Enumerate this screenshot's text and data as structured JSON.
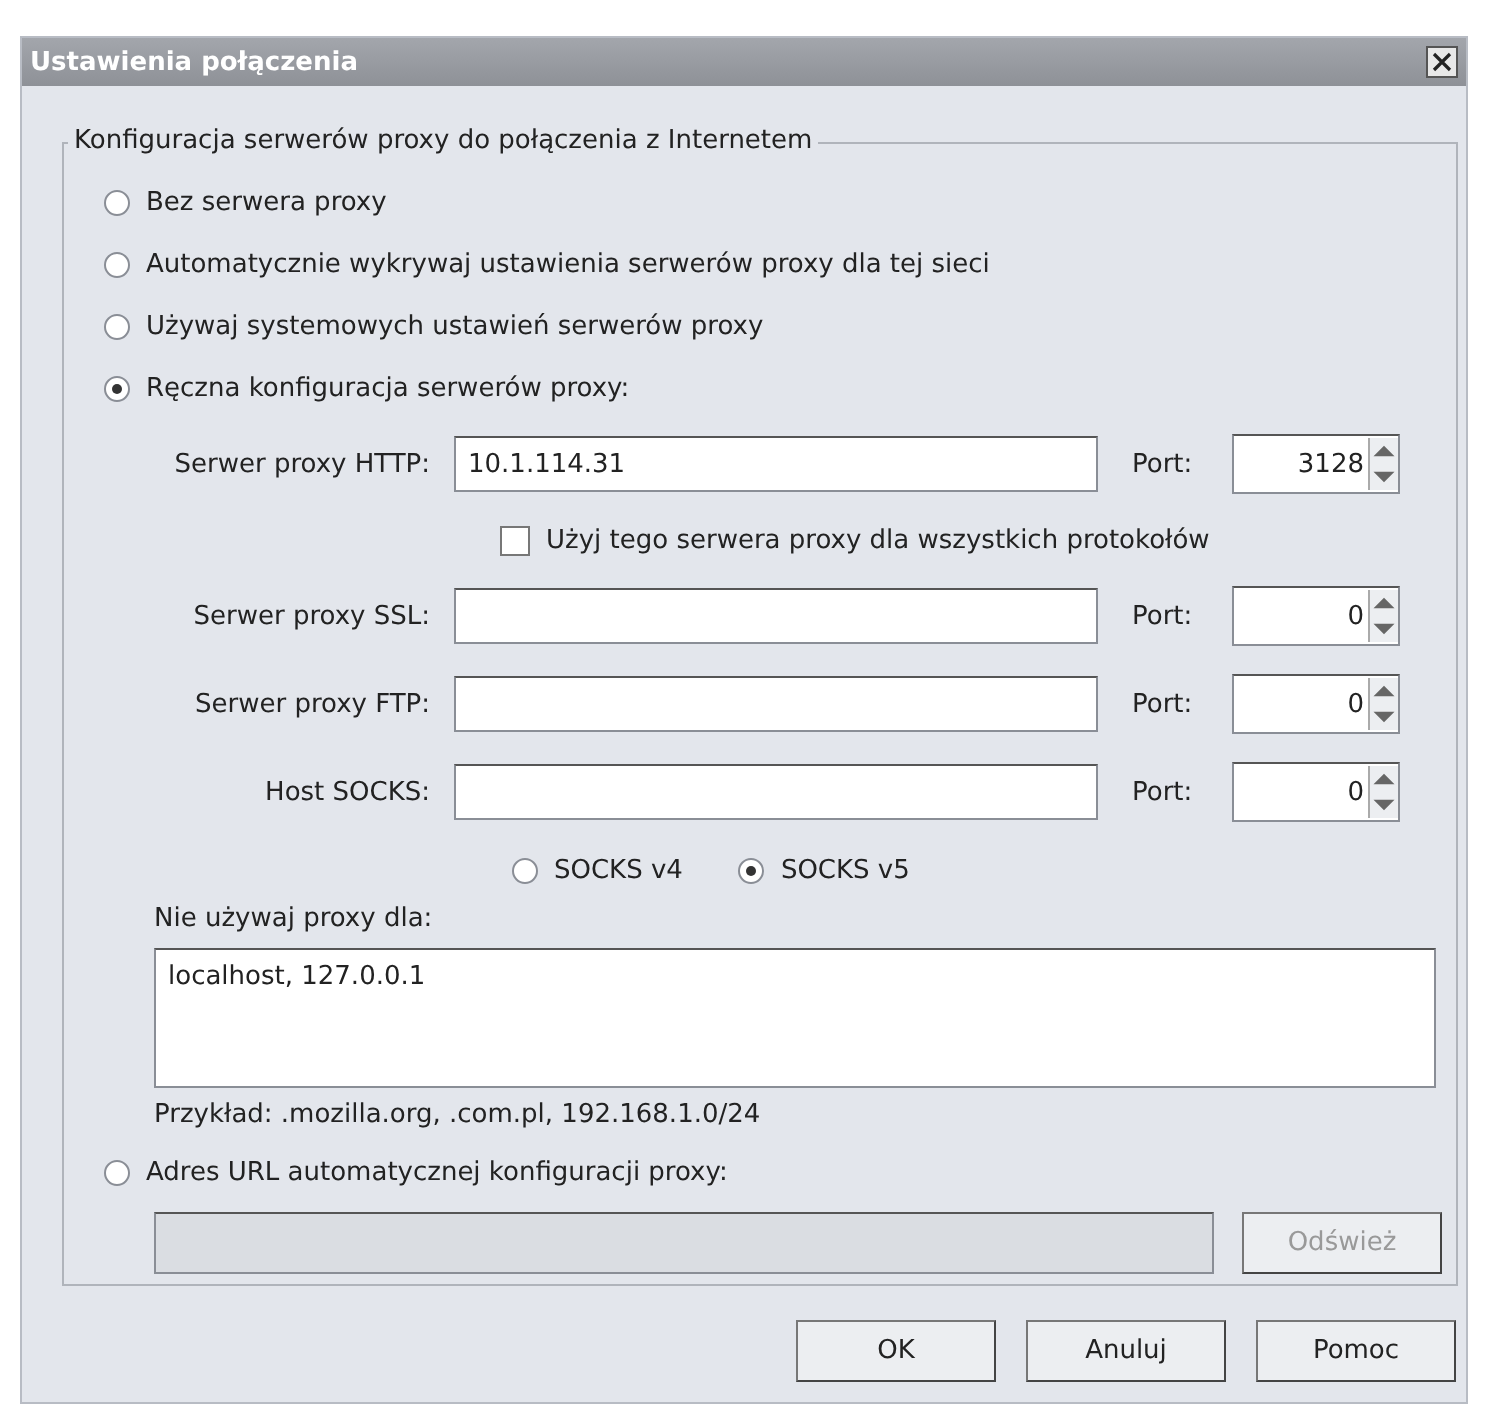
{
  "window": {
    "title": "Ustawienia połączenia"
  },
  "proxy_group": {
    "legend": "Konfiguracja serwerów proxy do połączenia z Internetem",
    "modes": [
      {
        "label": "Bez serwera proxy",
        "selected": false
      },
      {
        "label": "Automatycznie wykrywaj ustawienia serwerów proxy dla tej sieci",
        "selected": false
      },
      {
        "label": "Używaj systemowych ustawień serwerów proxy",
        "selected": false
      },
      {
        "label": "Ręczna konfiguracja serwerów proxy:",
        "selected": true
      }
    ],
    "servers": [
      {
        "label": "Serwer proxy HTTP:",
        "value": "10.1.114.31",
        "port_label": "Port:",
        "port": "3128"
      },
      {
        "label": "Serwer proxy SSL:",
        "port_label": "Port:",
        "port": "0"
      },
      {
        "label": "Serwer proxy FTP:",
        "port_label": "Port:",
        "port": "0"
      },
      {
        "label": "Host SOCKS:",
        "port_label": "Port:",
        "port": "0"
      }
    ],
    "use_for_all": {
      "label": "Użyj tego serwera proxy dla wszystkich protokołów",
      "checked": false
    },
    "socks_versions": [
      {
        "label": "SOCKS v4",
        "selected": false
      },
      {
        "label": "SOCKS v5",
        "selected": true
      }
    ],
    "no_proxy": {
      "label": "Nie używaj proxy dla:",
      "value": "localhost, 127.0.0.1"
    },
    "example": "Przykład: .mozilla.org, .com.pl, 192.168.1.0/24",
    "auto_config": {
      "label": "Adres URL automatycznej konfiguracji proxy:",
      "selected": false,
      "url_disabled": true,
      "reload": {
        "label": "Odśwież",
        "disabled": true
      }
    }
  },
  "buttons": [
    {
      "label": "OK"
    },
    {
      "label": "Anuluj"
    },
    {
      "label": "Pomoc"
    }
  ]
}
